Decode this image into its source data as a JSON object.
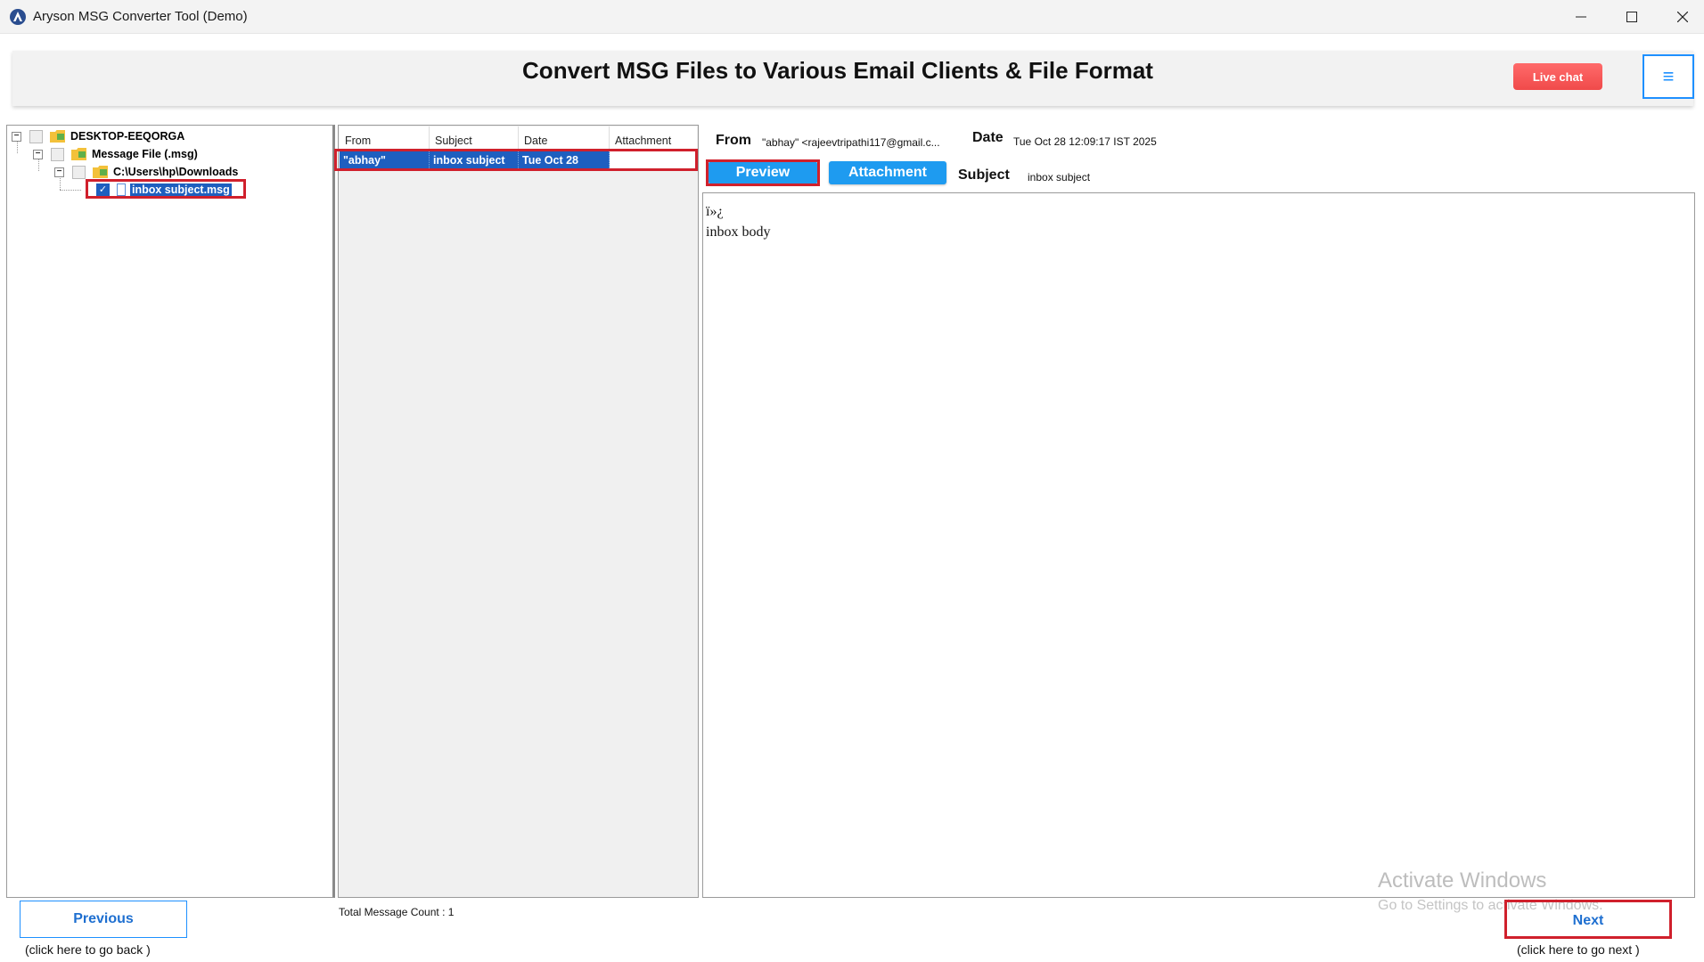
{
  "window": {
    "title": "Aryson MSG Converter Tool (Demo)",
    "controls": {
      "minimize": "minimize-icon",
      "maximize": "maximize-icon",
      "close": "close-icon"
    }
  },
  "header": {
    "title": "Convert MSG Files to Various Email Clients & File Format",
    "live_chat_label": "Live chat",
    "menu_glyph": "≡"
  },
  "tree": {
    "nodes": [
      {
        "label": "DESKTOP-EEQORGA",
        "checked": false
      },
      {
        "label": "Message File (.msg)",
        "checked": false
      },
      {
        "label": "C:\\Users\\hp\\Downloads",
        "checked": false
      },
      {
        "label": "inbox subject.msg",
        "checked": true,
        "selected": true
      }
    ]
  },
  "message_list": {
    "columns": [
      "From",
      "Subject",
      "Date",
      "Attachment"
    ],
    "rows": [
      {
        "from": "\"abhay\"",
        "subject": "inbox subject",
        "date": "Tue Oct 28",
        "attachment": ""
      }
    ],
    "count_text": "Total Message Count : 1"
  },
  "preview": {
    "from_label": "From",
    "from_value": "\"abhay\" <rajeevtripathi117@gmail.c...",
    "date_label": "Date",
    "date_value": "Tue Oct 28 12:09:17 IST 2025",
    "subject_label": "Subject",
    "subject_value": "inbox subject",
    "tab_preview": "Preview",
    "tab_attachment": "Attachment",
    "body_line1": "ï»¿",
    "body_line2": "inbox body"
  },
  "watermark": {
    "line1": "Activate Windows",
    "line2": "Go to Settings to activate Windows."
  },
  "footer": {
    "previous_label": "Previous",
    "previous_hint": "(click here to  go back )",
    "next_label": "Next",
    "next_hint": "(click here to  go next )"
  },
  "colors": {
    "accent_blue": "#1e9bf0",
    "selection_blue": "#1e5fbf",
    "live_chat_red": "#f04a4a",
    "highlight_red": "#d0202c"
  }
}
